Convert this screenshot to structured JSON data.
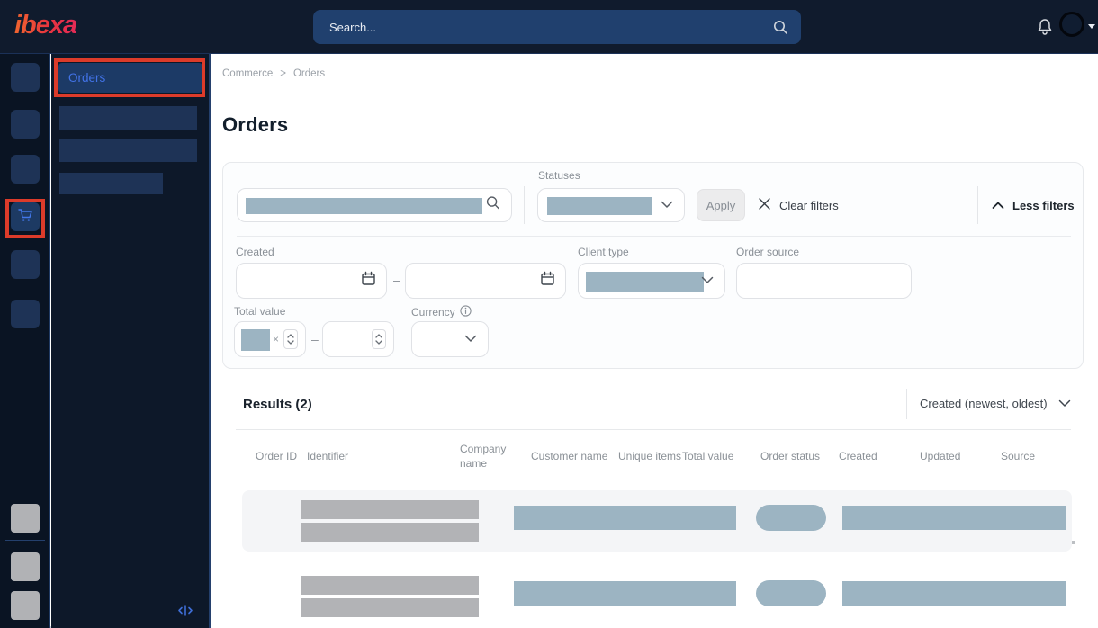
{
  "header": {
    "logo": "ibexa",
    "search_placeholder": "Search..."
  },
  "breadcrumb": {
    "items": [
      "Commerce",
      "Orders"
    ],
    "separator": ">"
  },
  "page": {
    "title": "Orders"
  },
  "sidebar": {
    "active_item": "Orders",
    "collapse_icon_name": "collapse-panel"
  },
  "filters": {
    "statuses_label": "Statuses",
    "apply_label": "Apply",
    "clear_label": "Clear filters",
    "less_label": "Less filters",
    "created_label": "Created",
    "client_type_label": "Client type",
    "order_source_label": "Order source",
    "total_value_label": "Total value",
    "currency_label": "Currency",
    "range_separator": "–"
  },
  "results": {
    "title": "Results (2)",
    "sort_label": "Created (newest, oldest)",
    "columns": [
      "Order ID",
      "Identifier",
      "Company name",
      "Customer name",
      "Unique items",
      "Total value",
      "Order status",
      "Created",
      "Updated",
      "Source"
    ],
    "row_count": 2
  },
  "colors": {
    "annotation_red": "#dc3b2a",
    "placeholder_blue": "#9cb4c2",
    "placeholder_gray": "#b2b3b6",
    "sidebar_link_blue": "#4273e8",
    "topbar_navy": "#101b2d",
    "brand_gradient": [
      "#f0652f",
      "#e42b57"
    ]
  }
}
